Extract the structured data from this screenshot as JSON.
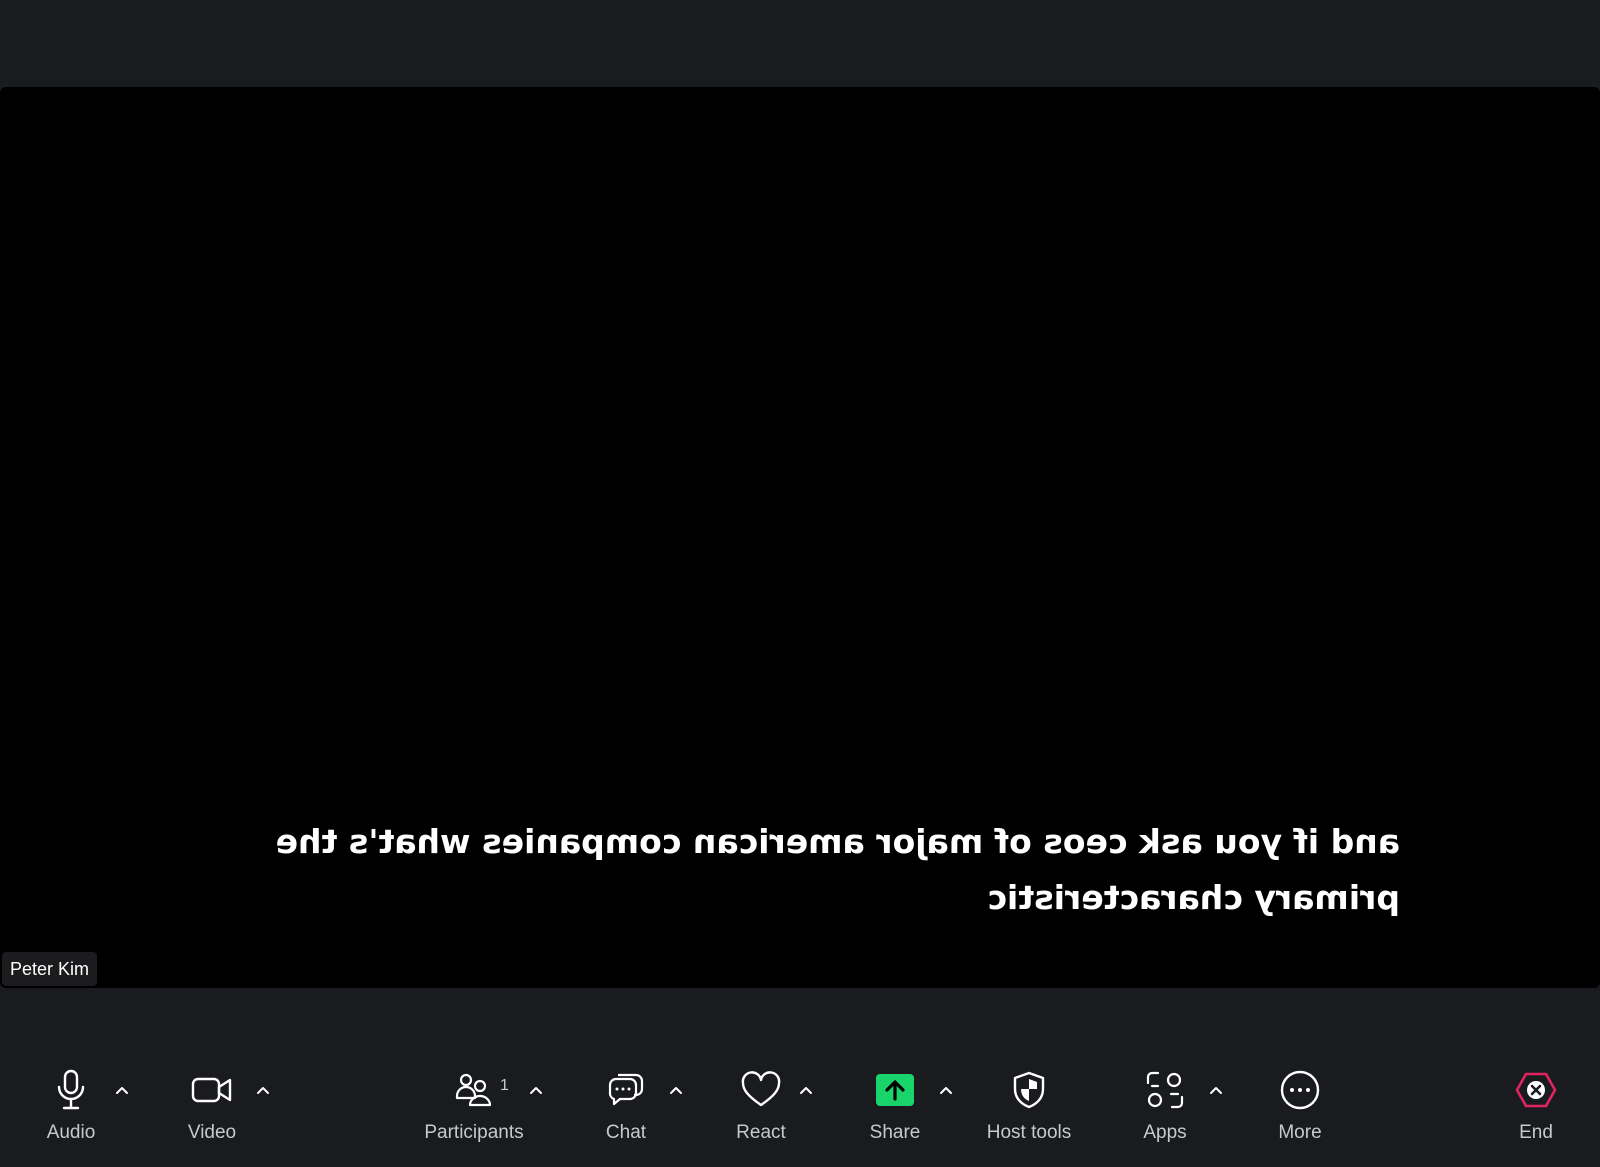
{
  "caption": {
    "line1": "and if you ask ceos of major american companies what's the",
    "line2": "primary characteristic"
  },
  "participant": {
    "name": "Peter Kim"
  },
  "toolbar": {
    "audio_label": "Audio",
    "video_label": "Video",
    "participants_label": "Participants",
    "participants_count": "1",
    "chat_label": "Chat",
    "react_label": "React",
    "share_label": "Share",
    "host_tools_label": "Host tools",
    "apps_label": "Apps",
    "more_label": "More",
    "end_label": "End"
  },
  "colors": {
    "background": "#1a1b1f",
    "video_background": "#000000",
    "share_accent": "#19d46b",
    "end_accent": "#e0245e",
    "label": "#c8c9cc"
  },
  "icons": {
    "audio": "microphone-icon",
    "video": "video-camera-icon",
    "participants": "participants-icon",
    "chat": "chat-icon",
    "react": "heart-icon",
    "share": "share-screen-icon",
    "host_tools": "shield-icon",
    "apps": "apps-icon",
    "more": "more-icon",
    "end": "end-icon",
    "caret": "chevron-up-icon"
  }
}
